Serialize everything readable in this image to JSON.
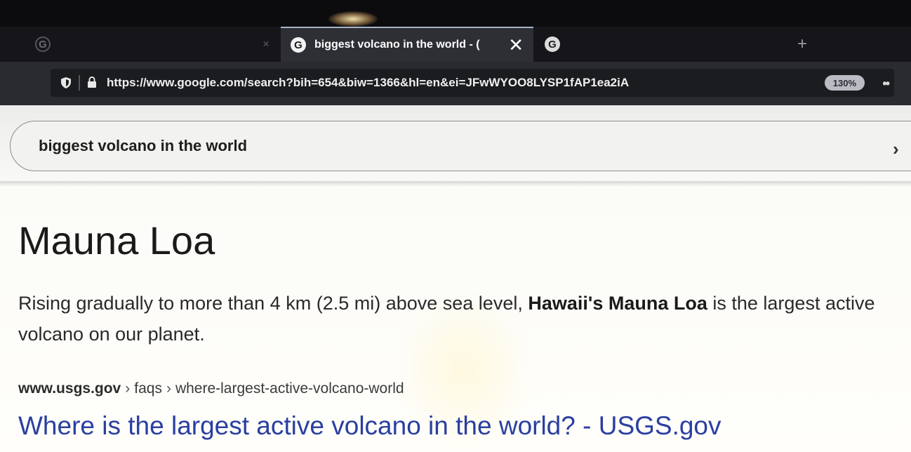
{
  "browser": {
    "tabs": [
      {
        "title": "",
        "close_icon": "×"
      },
      {
        "title": "biggest volcano in the world - (",
        "close_icon": "✕"
      },
      {
        "title": "",
        "close_icon": ""
      }
    ],
    "new_tab_icon": "+",
    "favicon_letter": "G",
    "url": "https://www.google.com/search?bih=654&biw=1366&hl=en&ei=JFwWYOO8LYSP1fAP1ea2iA",
    "zoom": "130%"
  },
  "search": {
    "query": "biggest volcano in the world",
    "clear_icon": "›"
  },
  "answer": {
    "title": "Mauna Loa",
    "snippet_pre": "Rising gradually to more than 4 km (2.5 mi) above sea level,",
    "snippet_bold": "Hawaii's Mauna Loa",
    "snippet_post": "is the largest active volcano on our planet."
  },
  "result": {
    "breadcrumb_domain": "www.usgs.gov",
    "breadcrumb_sep": "›",
    "breadcrumb_path_1": "faqs",
    "breadcrumb_path_2": "where-largest-active-volcano-world",
    "link_title": "Where is the largest active volcano in the world? - USGS.gov"
  }
}
